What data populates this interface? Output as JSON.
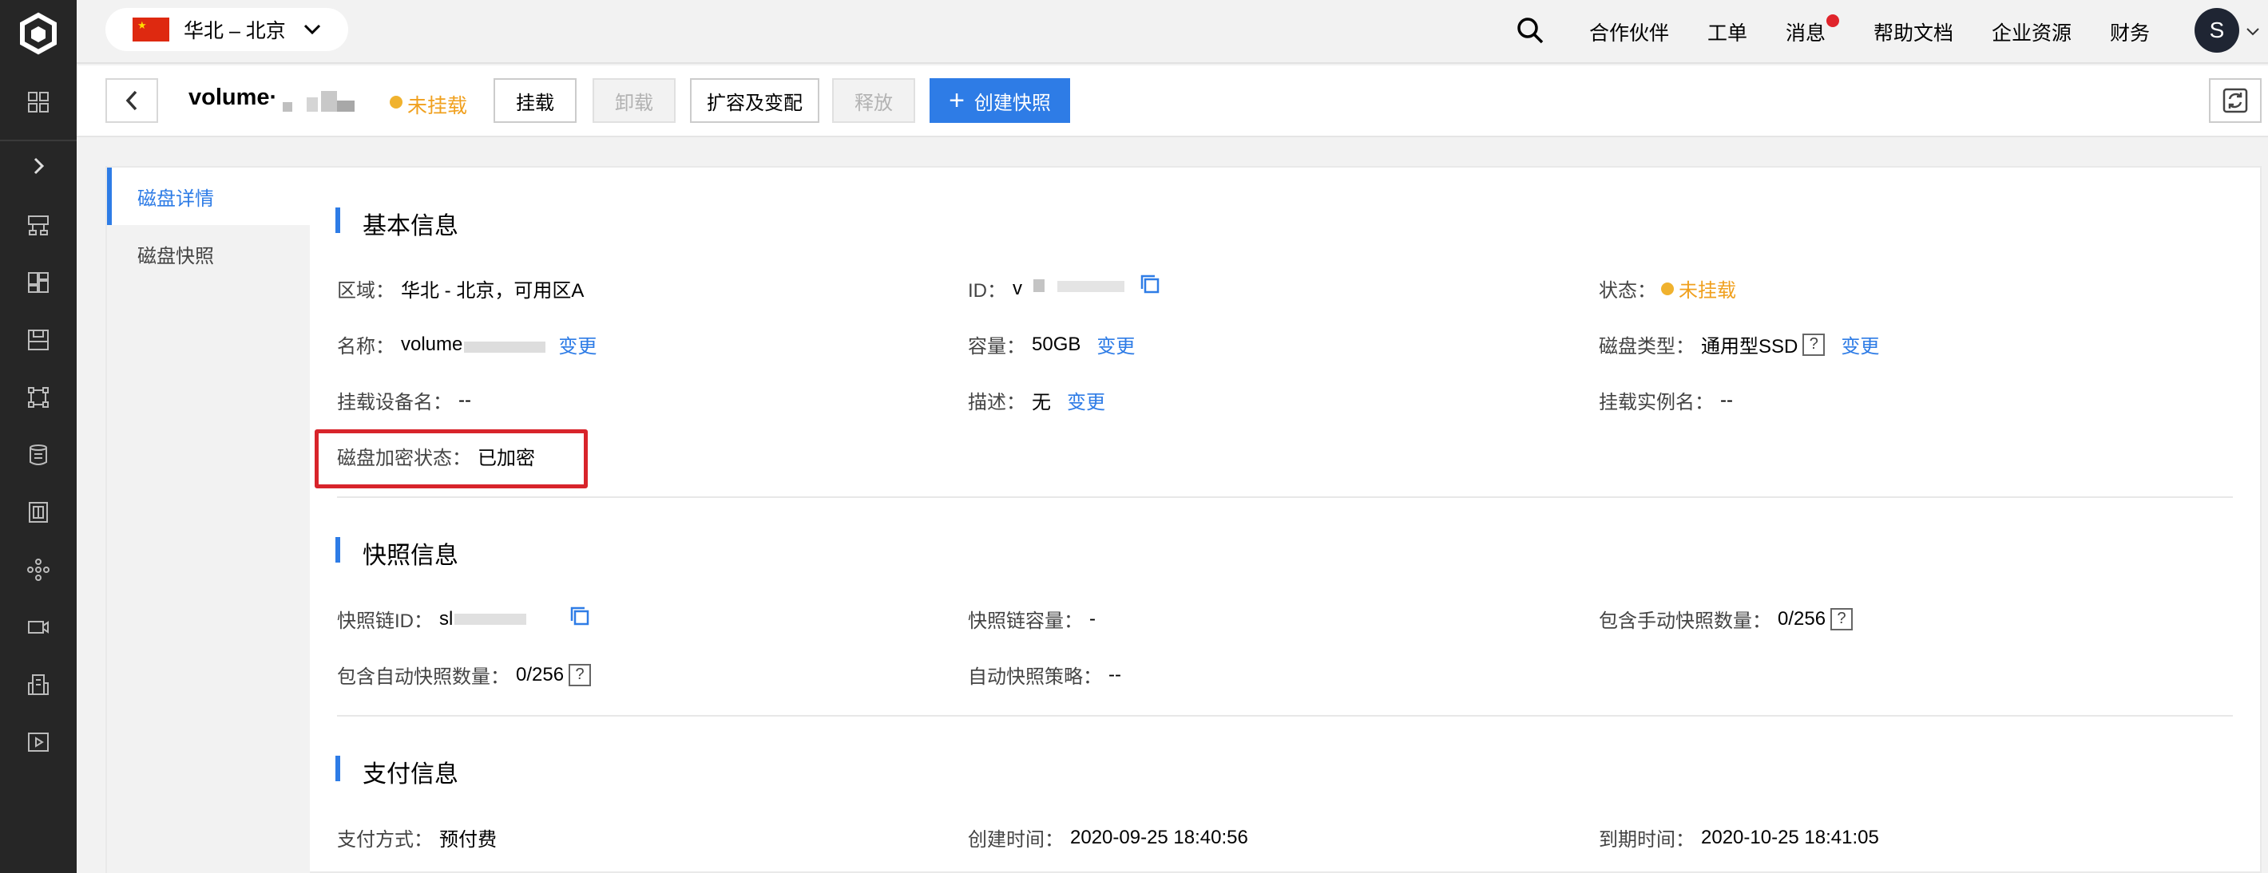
{
  "header": {
    "region_label": "华北 – 北京",
    "nav": [
      "合作伙伴",
      "工单",
      "消息",
      "帮助文档",
      "企业资源",
      "财务"
    ],
    "avatar_letter": "S"
  },
  "toolbar": {
    "title": "volume·",
    "status": "未挂载",
    "buttons": {
      "attach": "挂载",
      "detach": "卸载",
      "resize": "扩容及变配",
      "release": "释放",
      "create_snapshot": "创建快照"
    }
  },
  "side_tabs": [
    "磁盘详情",
    "磁盘快照"
  ],
  "basic": {
    "title": "基本信息",
    "region_label": "区域：",
    "region_value": "华北 - 北京，可用区A",
    "id_label": "ID：",
    "id_value": "v",
    "status_label": "状态：",
    "status_value": "未挂载",
    "name_label": "名称：",
    "name_value": "volume",
    "name_change": "变更",
    "capacity_label": "容量：",
    "capacity_value": "50GB",
    "capacity_change": "变更",
    "disk_type_label": "磁盘类型：",
    "disk_type_value": "通用型SSD",
    "disk_type_change": "变更",
    "mount_device_label": "挂载设备名：",
    "mount_device_value": "--",
    "desc_label": "描述：",
    "desc_value": "无",
    "desc_change": "变更",
    "mount_instance_label": "挂载实例名：",
    "mount_instance_value": "--",
    "encrypt_label": "磁盘加密状态：",
    "encrypt_value": "已加密"
  },
  "snapshot": {
    "title": "快照信息",
    "chain_id_label": "快照链ID：",
    "chain_id_value": "sl",
    "chain_capacity_label": "快照链容量：",
    "chain_capacity_value": "-",
    "manual_count_label": "包含手动快照数量：",
    "manual_count_value": "0/256",
    "auto_count_label": "包含自动快照数量：",
    "auto_count_value": "0/256",
    "auto_policy_label": "自动快照策略：",
    "auto_policy_value": "--"
  },
  "payment": {
    "title": "支付信息",
    "method_label": "支付方式：",
    "method_value": "预付费",
    "created_label": "创建时间：",
    "created_value": "2020-09-25 18:40:56",
    "expire_label": "到期时间：",
    "expire_value": "2020-10-25 18:41:05"
  },
  "colors": {
    "accent": "#2e7ce6",
    "warning": "#f0b22e",
    "highlight_box": "#d8242b",
    "nav_bg": "#262626"
  },
  "icons": [
    "logo-icon",
    "grid-icon",
    "expand-chevron-icon",
    "network-icon",
    "dashboard-icon",
    "storage-icon",
    "topology-icon",
    "database-icon",
    "building-icon",
    "cluster-icon",
    "video-icon",
    "office-icon",
    "play-icon",
    "search-icon",
    "chevron-down-icon",
    "back-icon",
    "plus-icon",
    "refresh-icon",
    "copy-icon",
    "help-icon"
  ]
}
